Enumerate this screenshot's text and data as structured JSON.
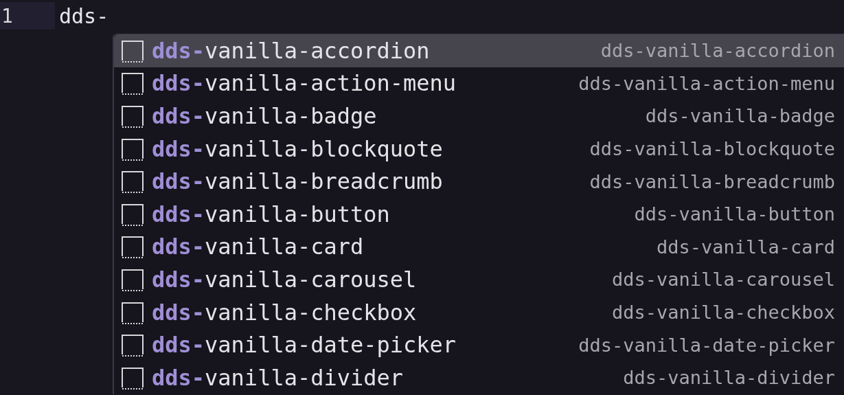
{
  "editor": {
    "line_number": "1",
    "text": "dds-"
  },
  "suggestions": [
    {
      "label": "**dds-**vanilla-accordion",
      "detail": "dds-vanilla-accordion",
      "selected": true
    },
    {
      "label": "**dds-**vanilla-action-menu",
      "detail": "dds-vanilla-action-menu",
      "selected": false
    },
    {
      "label": "**dds-**vanilla-badge",
      "detail": "dds-vanilla-badge",
      "selected": false
    },
    {
      "label": "**dds-**vanilla-blockquote",
      "detail": "dds-vanilla-blockquote",
      "selected": false
    },
    {
      "label": "**dds-**vanilla-breadcrumb",
      "detail": "dds-vanilla-breadcrumb",
      "selected": false
    },
    {
      "label": "**dds-**vanilla-button",
      "detail": "dds-vanilla-button",
      "selected": false
    },
    {
      "label": "**dds-**vanilla-card",
      "detail": "dds-vanilla-card",
      "selected": false
    },
    {
      "label": "**dds-**vanilla-carousel",
      "detail": "dds-vanilla-carousel",
      "selected": false
    },
    {
      "label": "**dds-**vanilla-checkbox",
      "detail": "dds-vanilla-checkbox",
      "selected": false
    },
    {
      "label": "**dds-**vanilla-date-picker",
      "detail": "dds-vanilla-date-picker",
      "selected": false
    },
    {
      "label": "**dds-**vanilla-divider",
      "detail": "dds-vanilla-divider",
      "selected": false
    }
  ]
}
